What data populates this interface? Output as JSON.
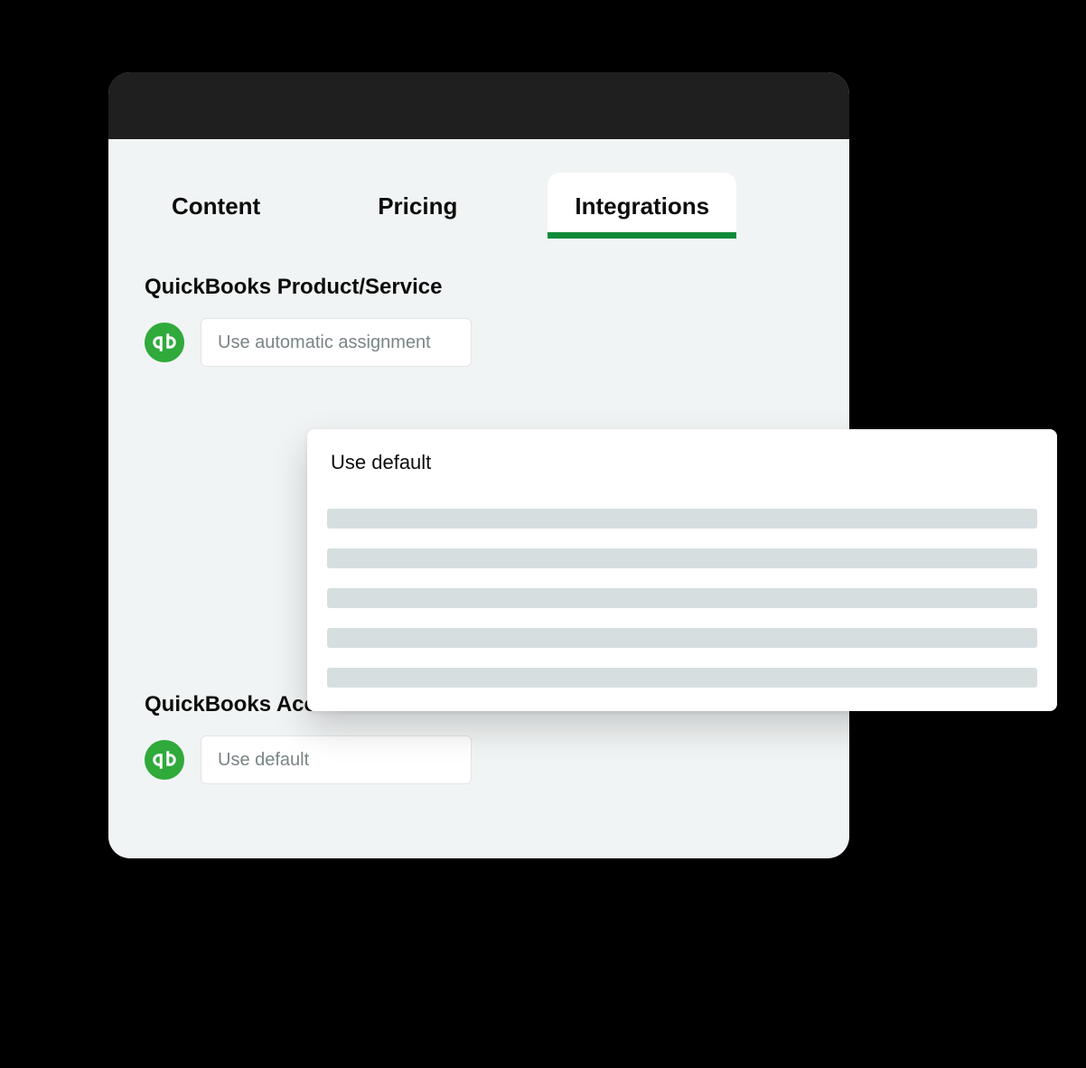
{
  "tabs": {
    "content": "Content",
    "pricing": "Pricing",
    "integrations": "Integrations"
  },
  "sections": {
    "productService": {
      "label": "QuickBooks Product/Service",
      "selectValue": "Use automatic assignment"
    },
    "accountCode": {
      "label": "QuickBooks Account Code",
      "selectValue": "Use default"
    }
  },
  "dropdown": {
    "option1": "Use default"
  },
  "colors": {
    "accent": "#0f8b3a",
    "qbGreen": "#2faa3b",
    "panelBg": "#f1f4f4",
    "placeholder": "#d6dee0"
  }
}
